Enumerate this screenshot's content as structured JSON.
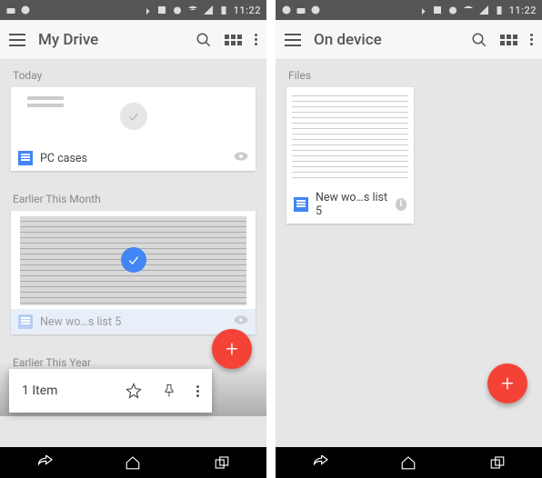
{
  "status": {
    "time": "11:22"
  },
  "left": {
    "title": "My Drive",
    "sections": {
      "today": "Today",
      "earlier_month": "Earlier This Month",
      "earlier_year": "Earlier This Year"
    },
    "files": {
      "pc_cases": "PC cases",
      "new_words": "New wo…s list 5"
    },
    "selection": {
      "count": "1 Item"
    }
  },
  "right": {
    "title": "On device",
    "sections": {
      "files": "Files"
    },
    "files": {
      "new_words": "New wo…s list 5"
    }
  }
}
